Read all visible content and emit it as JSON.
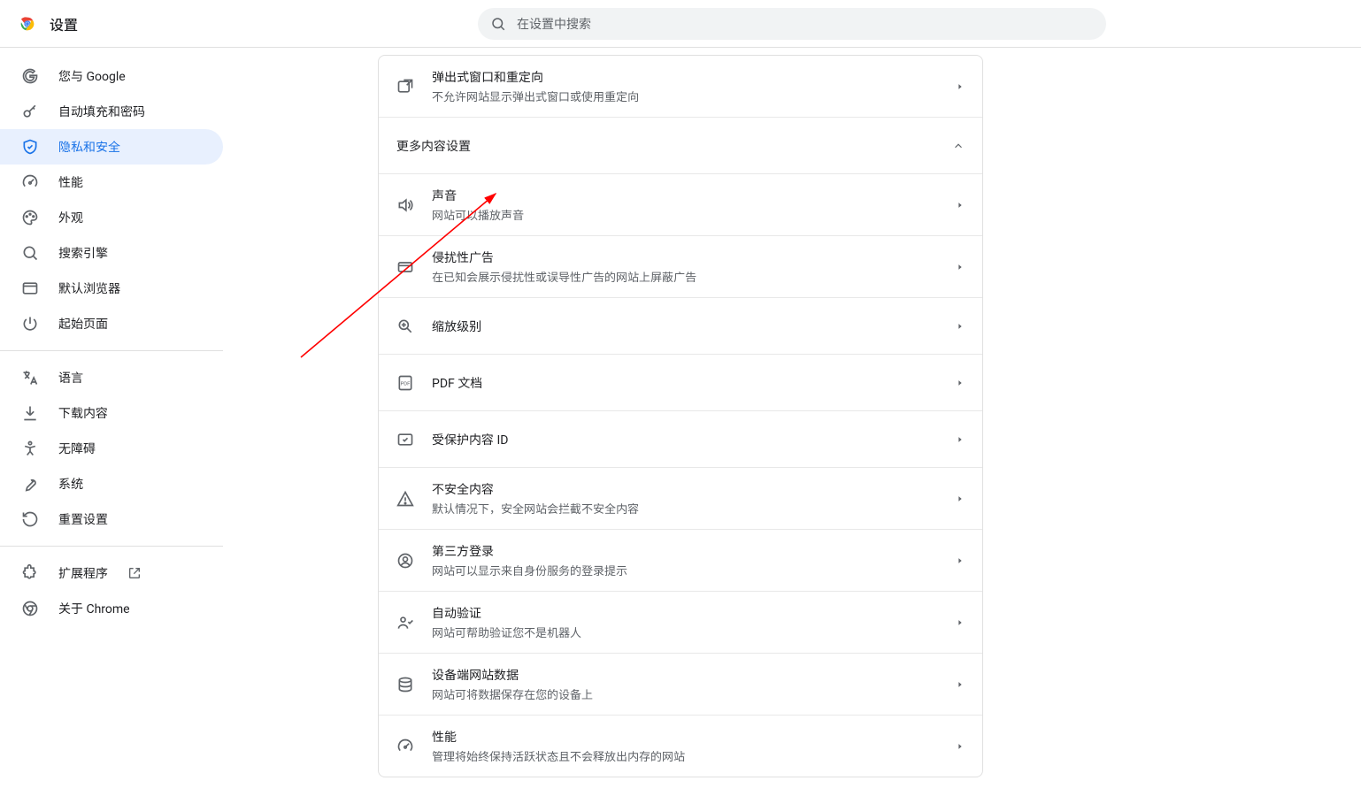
{
  "header": {
    "title": "设置",
    "search_placeholder": "在设置中搜索"
  },
  "sidebar": {
    "items": [
      {
        "label": "您与 Google"
      },
      {
        "label": "自动填充和密码"
      },
      {
        "label": "隐私和安全"
      },
      {
        "label": "性能"
      },
      {
        "label": "外观"
      },
      {
        "label": "搜索引擎"
      },
      {
        "label": "默认浏览器"
      },
      {
        "label": "起始页面"
      }
    ],
    "items2": [
      {
        "label": "语言"
      },
      {
        "label": "下载内容"
      },
      {
        "label": "无障碍"
      },
      {
        "label": "系统"
      },
      {
        "label": "重置设置"
      }
    ],
    "items3": [
      {
        "label": "扩展程序"
      },
      {
        "label": "关于 Chrome"
      }
    ]
  },
  "content": {
    "popup": {
      "title": "弹出式窗口和重定向",
      "sub": "不允许网站显示弹出式窗口或使用重定向"
    },
    "more_section_title": "更多内容设置",
    "rows": [
      {
        "title": "声音",
        "sub": "网站可以播放声音"
      },
      {
        "title": "侵扰性广告",
        "sub": "在已知会展示侵扰性或误导性广告的网站上屏蔽广告"
      },
      {
        "title": "缩放级别",
        "sub": ""
      },
      {
        "title": "PDF 文档",
        "sub": ""
      },
      {
        "title": "受保护内容 ID",
        "sub": ""
      },
      {
        "title": "不安全内容",
        "sub": "默认情况下，安全网站会拦截不安全内容"
      },
      {
        "title": "第三方登录",
        "sub": "网站可以显示来自身份服务的登录提示"
      },
      {
        "title": "自动验证",
        "sub": "网站可帮助验证您不是机器人"
      },
      {
        "title": "设备端网站数据",
        "sub": "网站可将数据保存在您的设备上"
      },
      {
        "title": "性能",
        "sub": "管理将始终保持活跃状态且不会释放出内存的网站"
      }
    ]
  }
}
